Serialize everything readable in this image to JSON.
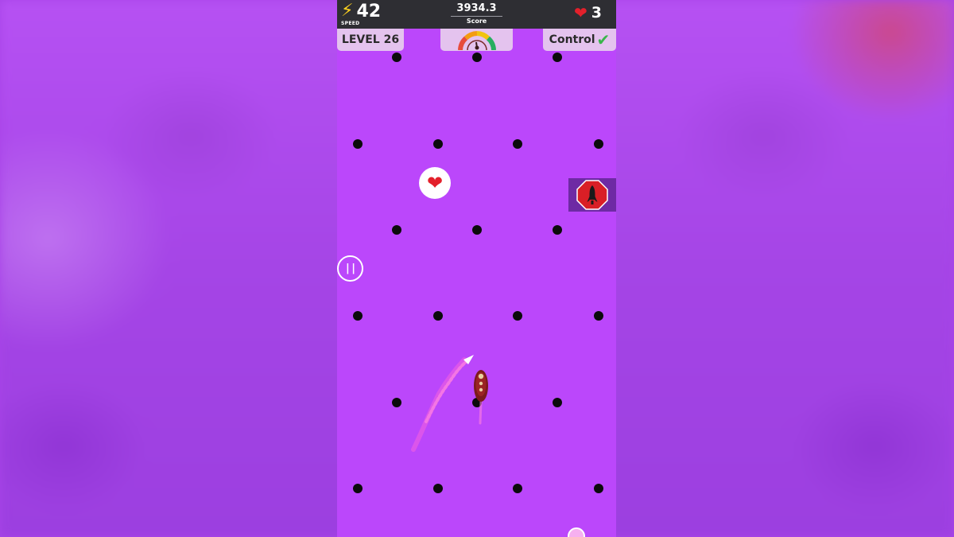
{
  "hud": {
    "speed_value": "42",
    "speed_label": "SPEED",
    "score_value": "3934.3",
    "score_label": "Score",
    "lives_value": "3",
    "level_label": "LEVEL 26",
    "control_label": "Control"
  },
  "icons": {
    "speed": "lightning-bolt",
    "lives": "heart",
    "control_status": "checkmark",
    "gauge": "speedometer",
    "pickup": "heart",
    "pause": "pause",
    "powerup": "rocket"
  },
  "colors": {
    "playfield": "#bb47fb",
    "topbar": "#2e2e33",
    "tab": "#e4c3ee",
    "bolt": "#ffd21f",
    "heart": "#e3202b",
    "check": "#39b54a",
    "dots": "#0b0b0b",
    "trail": "#ff66d8"
  }
}
